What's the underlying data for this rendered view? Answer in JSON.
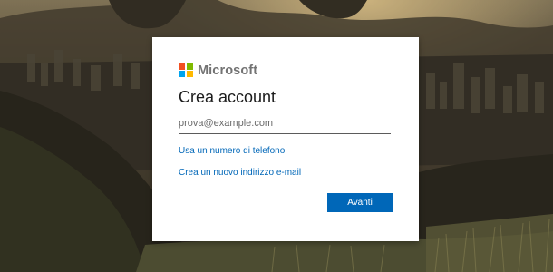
{
  "brand": {
    "name": "Microsoft",
    "logo_colors": [
      "#f25022",
      "#7fba00",
      "#00a4ef",
      "#ffb900"
    ]
  },
  "form": {
    "title": "Crea account",
    "email_placeholder": "prova@example.com",
    "email_value": "",
    "link_phone": "Usa un numero di telefono",
    "link_new_email": "Crea un nuovo indirizzo e-mail",
    "next_button": "Avanti"
  },
  "colors": {
    "accent": "#0067b8",
    "card_background": "#ffffff"
  }
}
